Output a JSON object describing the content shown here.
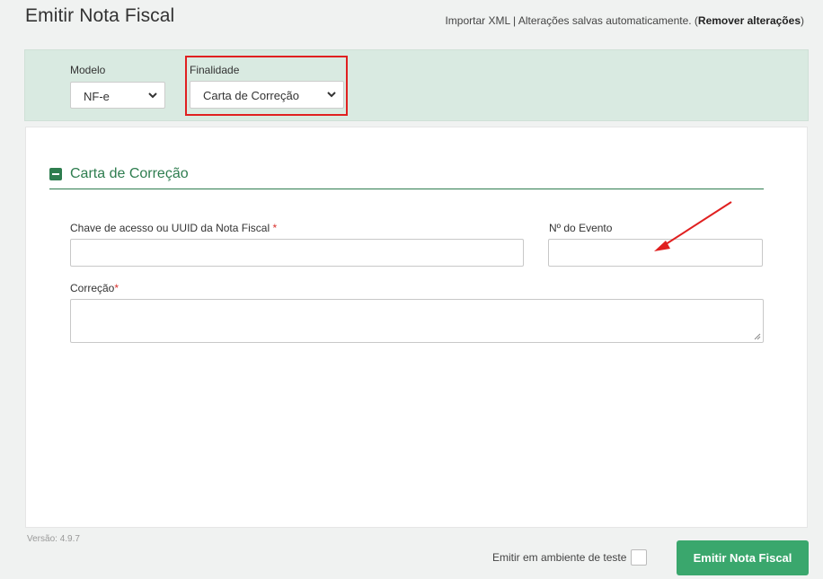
{
  "header": {
    "title": "Emitir Nota Fiscal",
    "import_xml": "Importar XML",
    "separator": "|",
    "autosave_text": "Alterações salvas automaticamente. (",
    "remove_changes": "Remover alterações",
    "autosave_close": ")"
  },
  "filters": {
    "modelo_label": "Modelo",
    "modelo_value": "NF-e",
    "finalidade_label": "Finalidade",
    "finalidade_value": "Carta de Correção"
  },
  "section": {
    "title": "Carta de Correção",
    "chave_label": "Chave de acesso ou UUID da Nota Fiscal",
    "chave_required": "*",
    "chave_value": "",
    "evento_label": "Nº do Evento",
    "evento_value": "",
    "correcao_label": "Correção",
    "correcao_required": "*",
    "correcao_value": ""
  },
  "footer": {
    "version": "Versão: 4.9.7",
    "test_env_label": "Emitir em ambiente de teste",
    "submit_label": "Emitir Nota Fiscal"
  },
  "colors": {
    "accent_green": "#3aa76d",
    "section_green": "#2e7d4f",
    "band_bg": "#d9eae1",
    "highlight_red": "#e02020"
  },
  "icons": [
    "chevron-down-icon",
    "minus-square-icon",
    "resize-handle-icon",
    "annotation-arrow-icon"
  ]
}
